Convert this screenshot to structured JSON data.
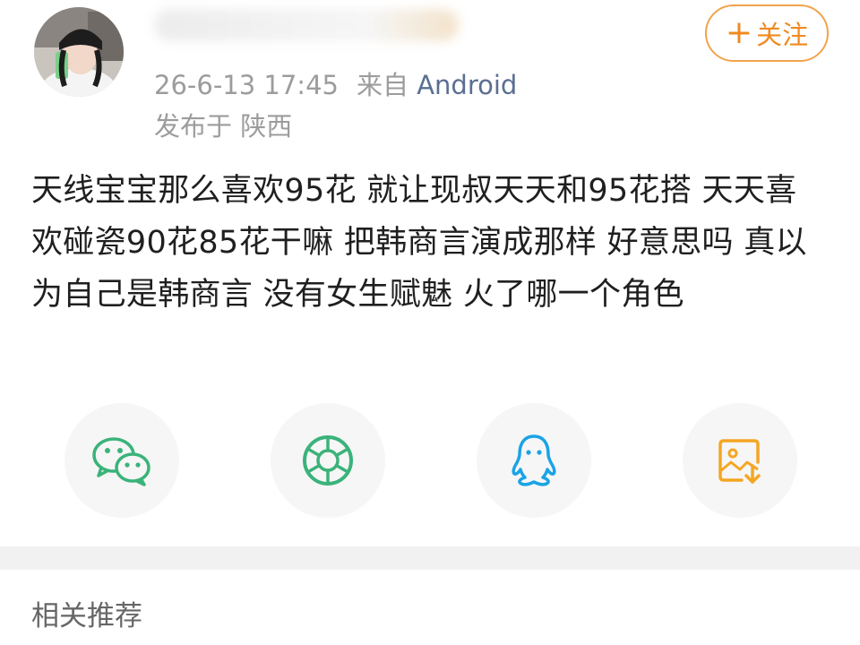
{
  "header": {
    "timestamp": "26-6-13 17:45",
    "source_prefix": "来自",
    "source": "Android",
    "location": "发布于 陕西",
    "follow_label": "关注"
  },
  "post": {
    "text": "天线宝宝那么喜欢95花 就让现叔天天和95花搭 天天喜欢碰瓷90花85花干嘛 把韩商言演成那样 好意思吗 真以为自己是韩商言 没有女生赋魅 火了哪一个角色"
  },
  "share_options": [
    {
      "icon": "wechat-icon",
      "color": "#3bb37a"
    },
    {
      "icon": "moments-icon",
      "color": "#3bb37a"
    },
    {
      "icon": "qq-icon",
      "color": "#1aa3e6"
    },
    {
      "icon": "save-image-icon",
      "color": "#f5a623"
    }
  ],
  "related": {
    "title": "相关推荐"
  }
}
